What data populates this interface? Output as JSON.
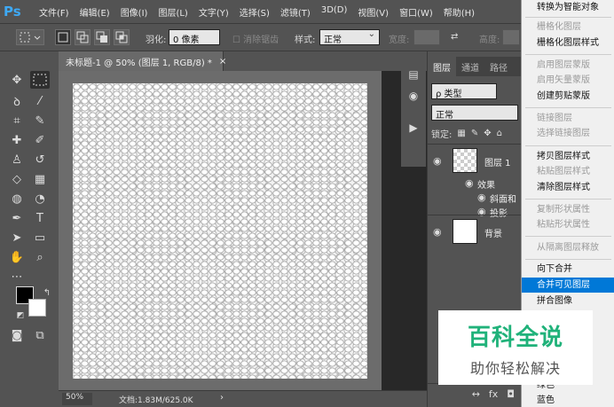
{
  "app": {
    "logo": "Ps"
  },
  "menubar": {
    "items": [
      "文件(F)",
      "编辑(E)",
      "图像(I)",
      "图层(L)",
      "文字(Y)",
      "选择(S)",
      "滤镜(T)",
      "3D(D)",
      "视图(V)",
      "窗口(W)",
      "帮助(H)"
    ]
  },
  "options": {
    "feather_label": "羽化:",
    "feather_value": "0 像素",
    "antialias_label": "消除锯齿",
    "style_label": "样式:",
    "style_value": "正常",
    "width_label": "宽度:",
    "height_label": "高度:"
  },
  "document": {
    "tab_title": "未标题-1 @ 50% (图层 1, RGB/8) *",
    "close_glyph": "×",
    "zoom": "50%",
    "info": "文档:1.83M/625.0K",
    "status_arrow": "›"
  },
  "layers_panel": {
    "tabs": [
      "图层",
      "通道",
      "路径"
    ],
    "filter_value": "ρ 类型",
    "blend_mode": "正常",
    "lock_label": "锁定:",
    "layers": [
      {
        "name": "图层 1",
        "type": "checker"
      },
      {
        "name": "效果",
        "type": "effects"
      },
      {
        "name": "斜面和",
        "type": "effect"
      },
      {
        "name": "投影",
        "type": "effect"
      },
      {
        "name": "背景",
        "type": "white"
      }
    ],
    "footer": [
      "↔",
      "fx",
      "◘"
    ]
  },
  "context_menu": {
    "items": [
      {
        "label": "转换为智能对象",
        "enabled": true
      },
      {
        "sep": true
      },
      {
        "label": "栅格化图层",
        "enabled": false
      },
      {
        "label": "栅格化图层样式",
        "enabled": true
      },
      {
        "sep": true
      },
      {
        "label": "启用图层蒙版",
        "enabled": false
      },
      {
        "label": "启用矢量蒙版",
        "enabled": false
      },
      {
        "label": "创建剪贴蒙版",
        "enabled": true
      },
      {
        "sep": true
      },
      {
        "label": "链接图层",
        "enabled": false
      },
      {
        "label": "选择链接图层",
        "enabled": false
      },
      {
        "sep": true
      },
      {
        "label": "拷贝图层样式",
        "enabled": true
      },
      {
        "label": "粘贴图层样式",
        "enabled": false
      },
      {
        "label": "清除图层样式",
        "enabled": true
      },
      {
        "sep": true
      },
      {
        "label": "复制形状属性",
        "enabled": false
      },
      {
        "label": "粘贴形状属性",
        "enabled": false
      },
      {
        "sep": true
      },
      {
        "label": "从隔离图层释放",
        "enabled": false
      },
      {
        "sep": true
      },
      {
        "label": "向下合并",
        "enabled": true
      },
      {
        "label": "合并可见图层",
        "enabled": true,
        "selected": true
      },
      {
        "label": "拼合图像",
        "enabled": true
      },
      {
        "label": "绿色",
        "enabled": true
      },
      {
        "label": "蓝色",
        "enabled": true
      }
    ]
  },
  "watermark": {
    "title": "百科全说",
    "subtitle": "助你轻松解决"
  }
}
